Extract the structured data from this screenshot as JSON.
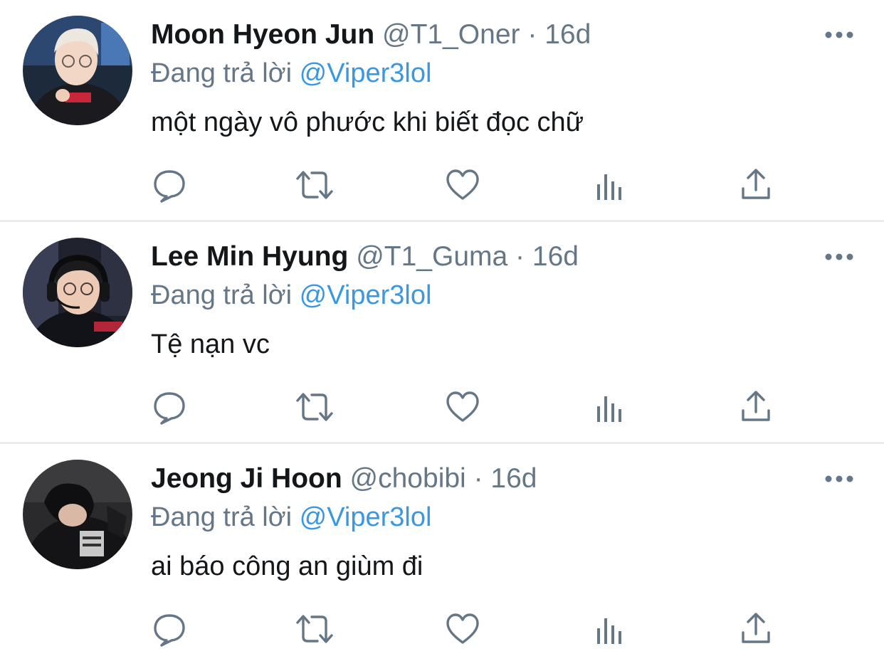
{
  "colors": {
    "primary_text": "#14171a",
    "secondary_text": "#657786",
    "mention": "#3a98e3",
    "icon": "#657786",
    "divider": "#e6ecf0"
  },
  "tweets": [
    {
      "display_name": "Moon Hyeon Jun",
      "handle": "@T1_Oner",
      "separator": "·",
      "time": "16d",
      "replying_prefix": "Đang trả lời",
      "replying_to": "@Viper3lol",
      "text": "một ngày vô phước khi biết đọc chữ",
      "avatar_icon": "avatar-photo"
    },
    {
      "display_name": "Lee Min Hyung",
      "handle": "@T1_Guma",
      "separator": "·",
      "time": "16d",
      "replying_prefix": "Đang trả lời",
      "replying_to": "@Viper3lol",
      "text": "Tệ nạn vc",
      "avatar_icon": "avatar-photo"
    },
    {
      "display_name": "Jeong Ji Hoon",
      "handle": "@chobibi",
      "separator": "·",
      "time": "16d",
      "replying_prefix": "Đang trả lời",
      "replying_to": "@Viper3lol",
      "text": "ai báo công an giùm đi",
      "avatar_icon": "avatar-photo"
    }
  ],
  "action_icons": [
    "reply-icon",
    "retweet-icon",
    "like-icon",
    "analytics-icon",
    "share-icon"
  ],
  "more_icon": "more-options-icon"
}
